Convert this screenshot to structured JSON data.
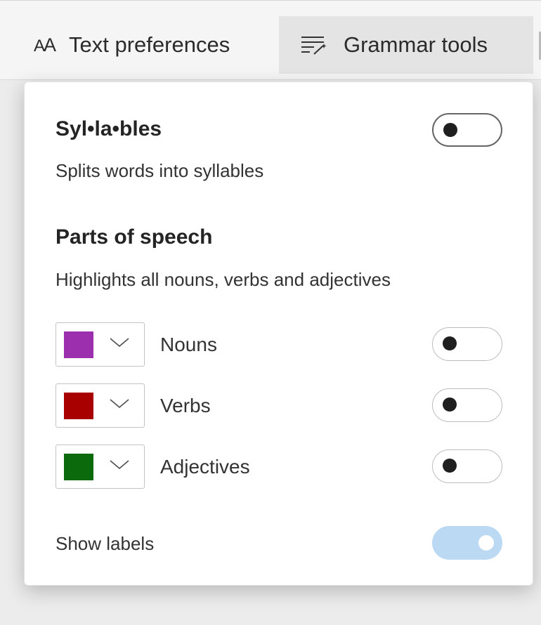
{
  "toolbar": {
    "text_preferences": {
      "label": "Text preferences",
      "icon": "text-size-icon"
    },
    "grammar_tools": {
      "label": "Grammar tools",
      "icon": "grammar-wand-icon"
    }
  },
  "panel": {
    "syllables": {
      "title": "Syl•la•bles",
      "description": "Splits words into syllables",
      "enabled": false
    },
    "parts_of_speech": {
      "title": "Parts of speech",
      "description": "Highlights all nouns, verbs and adjectives",
      "items": [
        {
          "label": "Nouns",
          "color": "#9b2fae",
          "enabled": false
        },
        {
          "label": "Verbs",
          "color": "#a80000",
          "enabled": false
        },
        {
          "label": "Adjectives",
          "color": "#0b6a0b",
          "enabled": false
        }
      ]
    },
    "show_labels": {
      "label": "Show labels",
      "enabled": true
    }
  },
  "colors": {
    "toggle_on": "#bcd9f3",
    "toolbar_bg": "#f5f5f5",
    "active_tab_bg": "#e4e4e4"
  }
}
